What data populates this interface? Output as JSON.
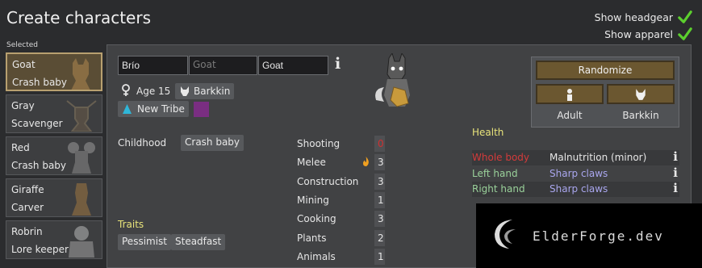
{
  "window": {
    "title": "Create characters"
  },
  "toggles": [
    {
      "label": "Show headgear",
      "checked": true
    },
    {
      "label": "Show apparel",
      "checked": true
    }
  ],
  "sidebar": {
    "selected_label": "Selected",
    "pawns": [
      {
        "name": "Goat",
        "role": "Crash baby",
        "selected": true
      },
      {
        "name": "Gray",
        "role": "Scavenger",
        "selected": false
      },
      {
        "name": "Red",
        "role": "Crash baby",
        "selected": false
      },
      {
        "name": "Giraffe",
        "role": "Carver",
        "selected": false
      },
      {
        "name": "Robrin",
        "role": "Lore keeper",
        "selected": false
      }
    ]
  },
  "character": {
    "first_name": "Brío",
    "nickname_placeholder": "Goat",
    "last_name": "Goat",
    "info_glyph": "i",
    "age": "Age 15",
    "xenotype": "Barkkin",
    "faction": "New Tribe",
    "faction_color": "#7a2e82",
    "gender_icon": "female-icon"
  },
  "backstory": {
    "label": "Childhood",
    "value": "Crash baby"
  },
  "traits": {
    "label": "Traits",
    "items": [
      "Pessimist",
      "Steadfast"
    ]
  },
  "skills": [
    {
      "name": "Shooting",
      "value": "0",
      "passion": false
    },
    {
      "name": "Melee",
      "value": "3",
      "passion": true
    },
    {
      "name": "Construction",
      "value": "3",
      "passion": false
    },
    {
      "name": "Mining",
      "value": "1",
      "passion": false
    },
    {
      "name": "Cooking",
      "value": "3",
      "passion": false
    },
    {
      "name": "Plants",
      "value": "2",
      "passion": false
    },
    {
      "name": "Animals",
      "value": "1",
      "passion": false
    }
  ],
  "buttons": {
    "randomize": "Randomize",
    "adult": "Adult",
    "xenotype": "Barkkin"
  },
  "health": {
    "title": "Health",
    "rows": [
      {
        "part": "Whole body",
        "condition": "Malnutrition (minor)",
        "part_color": "#d33b3b",
        "cond_color": "#e6e6e6"
      },
      {
        "part": "Left hand",
        "condition": "Sharp claws",
        "part_color": "#9ad19a",
        "cond_color": "#a9a6ee"
      },
      {
        "part": "Right hand",
        "condition": "Sharp claws",
        "part_color": "#9ad19a",
        "cond_color": "#a9a6ee"
      }
    ]
  },
  "watermark": {
    "text": "ElderForge.dev"
  },
  "colors": {
    "accent_gold": "#b8a070",
    "health_yellow": "#e8e37a",
    "check_green": "#5ccf2e",
    "skill_zero": "#d03030"
  }
}
